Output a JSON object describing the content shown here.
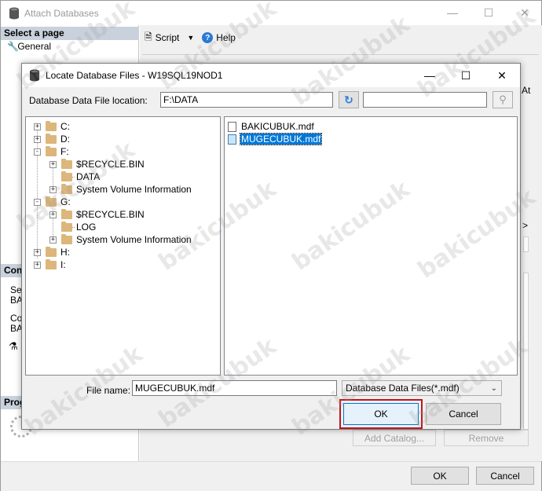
{
  "outer_window": {
    "title": "Attach Databases",
    "left_pane": {
      "select_page_header": "Select a page",
      "pages": [
        "General"
      ],
      "connection_header": "Con",
      "connection_lines": [
        "Ser",
        "BA",
        "Cor",
        "BA"
      ],
      "progress_header": "Prog"
    },
    "toolbar": {
      "script_label": "Script",
      "help_label": "Help"
    },
    "right_edge_labels": {
      "at": "At",
      "arrow": ">"
    },
    "add_catalog_label": "Add Catalog...",
    "remove_label": "Remove",
    "ok_label": "OK",
    "cancel_label": "Cancel"
  },
  "dialog": {
    "title": "Locate Database Files - W19SQL19NOD1",
    "location_label": "Database Data File location:",
    "location_value": "F:\\DATA",
    "search_value": "",
    "tree": [
      {
        "label": "C:",
        "level": 0,
        "expander": "+"
      },
      {
        "label": "D:",
        "level": 0,
        "expander": "+"
      },
      {
        "label": "F:",
        "level": 0,
        "expander": "-"
      },
      {
        "label": "$RECYCLE.BIN",
        "level": 1,
        "expander": "+"
      },
      {
        "label": "DATA",
        "level": 1,
        "expander": ""
      },
      {
        "label": "System Volume Information",
        "level": 1,
        "expander": "+"
      },
      {
        "label": "G:",
        "level": 0,
        "expander": "-"
      },
      {
        "label": "$RECYCLE.BIN",
        "level": 1,
        "expander": "+"
      },
      {
        "label": "LOG",
        "level": 1,
        "expander": ""
      },
      {
        "label": "System Volume Information",
        "level": 1,
        "expander": "+"
      },
      {
        "label": "H:",
        "level": 0,
        "expander": "+"
      },
      {
        "label": "I:",
        "level": 0,
        "expander": "+"
      }
    ],
    "files": [
      {
        "name": "BAKICUBUK.mdf",
        "selected": false
      },
      {
        "name": "MUGECUBUK.mdf",
        "selected": true
      }
    ],
    "file_name_label": "File name:",
    "file_name_value": "MUGECUBUK.mdf",
    "file_type_value": "Database Data Files(*.mdf)",
    "ok_label": "OK",
    "cancel_label": "Cancel"
  },
  "colors": {
    "selection": "#0078d7",
    "highlight_border": "#c0161c",
    "folder": "#dcb67a"
  },
  "watermark_text": "bakicubuk"
}
